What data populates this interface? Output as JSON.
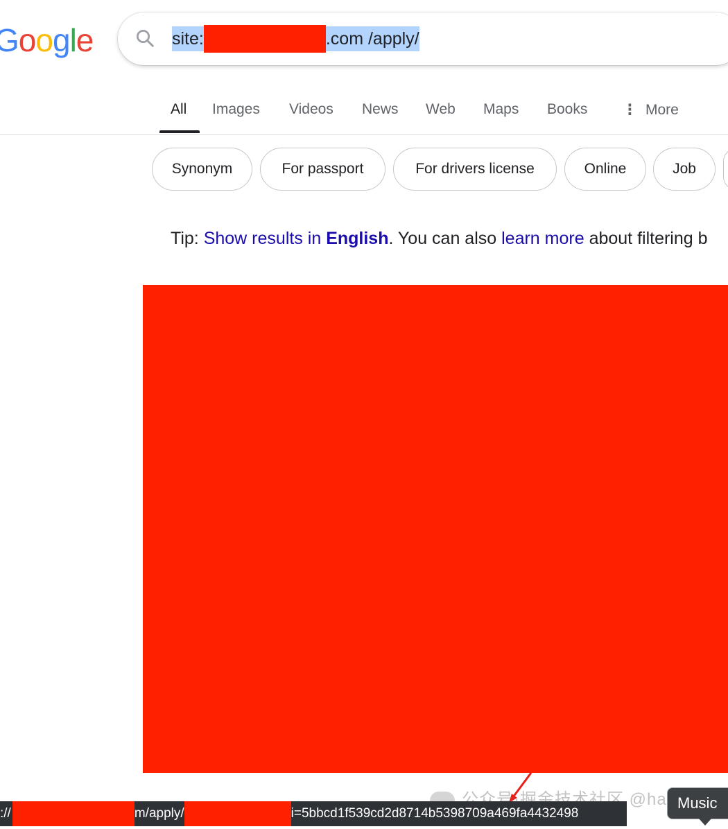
{
  "logo": {
    "letters": [
      "G",
      "o",
      "o",
      "g",
      "l",
      "e"
    ],
    "colors": [
      "#4285f4",
      "#ea4335",
      "#fbbc05",
      "#4285f4",
      "#34a853",
      "#ea4335"
    ]
  },
  "search": {
    "query_prefix": "site:",
    "query_suffix": ".com /apply/"
  },
  "tabs": [
    {
      "label": "All",
      "active": true
    },
    {
      "label": "Images"
    },
    {
      "label": "Videos"
    },
    {
      "label": "News"
    },
    {
      "label": "Web"
    },
    {
      "label": "Maps"
    },
    {
      "label": "Books"
    },
    {
      "label": "More"
    }
  ],
  "chips": [
    "Synonym",
    "For passport",
    "For drivers license",
    "Online",
    "Job"
  ],
  "tip": {
    "prefix": "Tip: ",
    "link1": "Show results in",
    "link1_bold": "English",
    "middle": ". You can also ",
    "link2": "learn more",
    "suffix": " about filtering b"
  },
  "statusbar": {
    "part1": "://",
    "part2": "m/apply/",
    "part3": "i=5bbcd1f539cd2d8714b5398709a469fa4432498"
  },
  "watermark": "公众号·掘金技术社区 @haidragon",
  "tooltip": "Music",
  "colors": {
    "redaction": "#ff2000",
    "selection": "#b3d4fd",
    "link": "#1a0dab"
  }
}
